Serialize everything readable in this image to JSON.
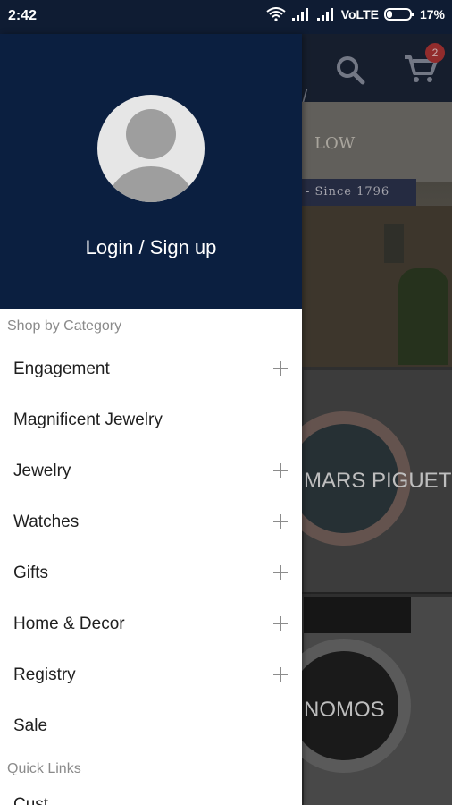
{
  "status_bar": {
    "time": "2:42",
    "network": "VoLTE",
    "battery": "17%"
  },
  "background_app": {
    "header": {
      "search_icon": "search-icon",
      "cart_icon": "cart-icon",
      "cart_count": "2"
    },
    "hero": {
      "sign_text": "LOW",
      "awning_text": "- Since 1796"
    },
    "tiles": [
      {
        "label": "MARS PIGUET"
      },
      {
        "label": "NOMOS"
      }
    ]
  },
  "drawer": {
    "avatar_icon": "avatar-placeholder-icon",
    "login_label": "Login / Sign up",
    "shop_by_category_label": "Shop by Category",
    "categories": [
      {
        "label": "Engagement",
        "expandable": true
      },
      {
        "label": "Magnificent Jewelry",
        "expandable": false
      },
      {
        "label": "Jewelry",
        "expandable": true
      },
      {
        "label": "Watches",
        "expandable": true
      },
      {
        "label": "Gifts",
        "expandable": true
      },
      {
        "label": "Home & Decor",
        "expandable": true
      },
      {
        "label": "Registry",
        "expandable": true
      },
      {
        "label": "Sale",
        "expandable": false
      }
    ],
    "quick_links_label": "Quick Links",
    "quick_links": [
      {
        "label": "Cust..."
      }
    ]
  },
  "colors": {
    "drawer_header_bg": "#0b1f40",
    "status_bar_bg": "#0f1c33",
    "badge": "#b23636"
  }
}
